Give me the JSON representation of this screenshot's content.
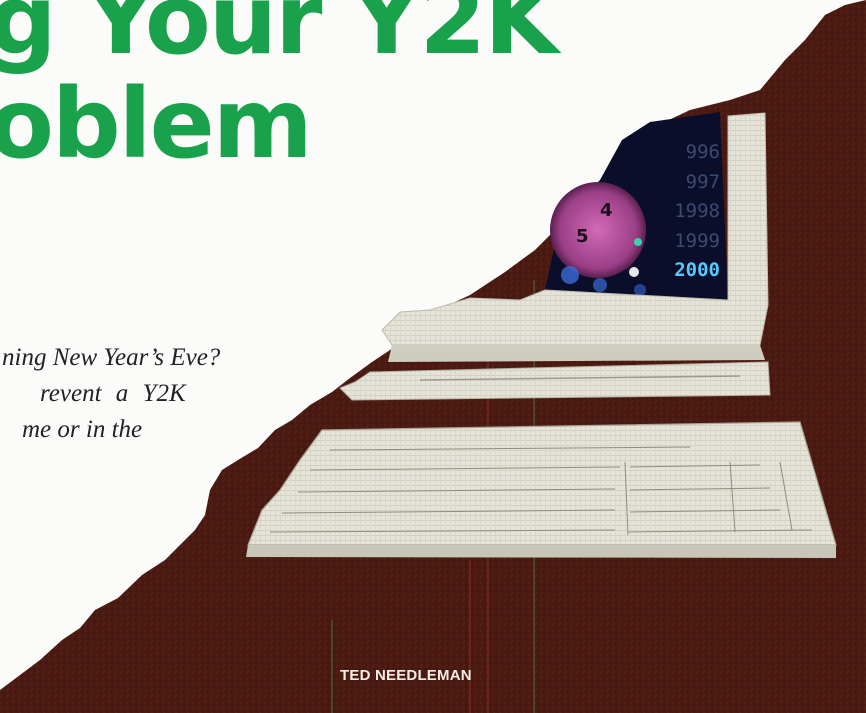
{
  "article": {
    "headline_lines": [
      "g Your Y2K",
      "oblem"
    ],
    "intro_lines": [
      "ning New Year’s Eve?",
      "revent a Y2K",
      "me or in the"
    ],
    "byline": "TED NEEDLEMAN"
  },
  "illustration": {
    "screen_years": [
      "996",
      "997",
      "1998",
      "1999",
      "2000"
    ],
    "active_year": "2000",
    "clock_numbers": [
      "4",
      "5"
    ],
    "icons": [
      "computer-monitor-icon",
      "keyboard-icon",
      "clock-icon"
    ]
  },
  "colors": {
    "headline": "#19a24b",
    "background_art": "#4a1a12",
    "page": "#fbfbfa",
    "byline": "#f4efe6",
    "screen": "#0a0e2a",
    "active_year": "#58c9ff"
  }
}
